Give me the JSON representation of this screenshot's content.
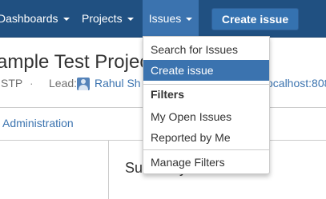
{
  "nav": {
    "dashboards_label": "Dashboards",
    "projects_label": "Projects",
    "issues_label": "Issues",
    "create_issue_button": "Create issue",
    "colors": {
      "bar": "#205081",
      "active": "#3b73af",
      "button": "#3572b0"
    }
  },
  "project": {
    "title": "ample Test Projec",
    "key": "STP",
    "separator": "·",
    "lead_label": "Lead:",
    "lead_name": "Rahul Sh",
    "url": "ocalhost:808"
  },
  "tabs": {
    "administration_label": "Administration"
  },
  "main": {
    "summary_heading": "Summary"
  },
  "issues_menu": {
    "items": [
      {
        "label": "Search for Issues"
      },
      {
        "label": "Create issue",
        "active": true
      }
    ],
    "filters_heading": "Filters",
    "filters": [
      {
        "label": "My Open Issues"
      },
      {
        "label": "Reported by Me"
      }
    ],
    "manage_filters_label": "Manage Filters"
  }
}
